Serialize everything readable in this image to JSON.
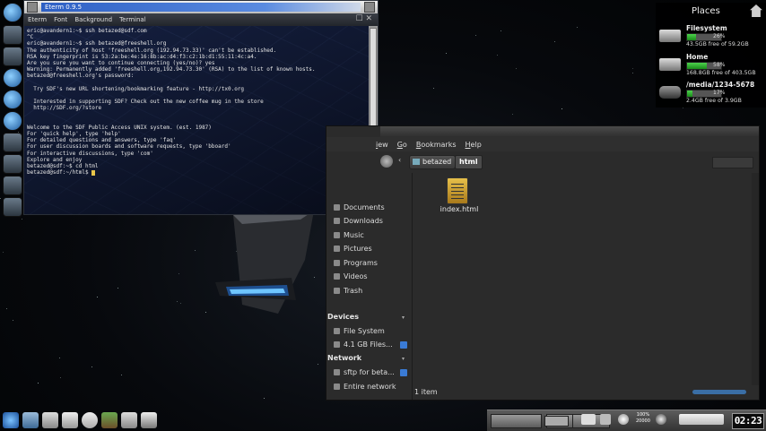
{
  "terminal": {
    "title": "Eterm 0.9.5",
    "menu": [
      "Eterm",
      "Font",
      "Background",
      "Terminal"
    ],
    "lines": [
      "eric@avandern1:~$ ssh betazed@sdf.com",
      "^C",
      "eric@avandern1:~$ ssh betazed@freeshell.org",
      "The authenticity of host 'freeshell.org (192.94.73.33)' can't be established.",
      "RSA key fingerprint is 53:2a:be:4e:16:8b:ac:d4:f3:c2:1b:d1:55:11:4c:a4.",
      "Are you sure you want to continue connecting (yes/no)? yes",
      "Warning: Permanently added 'freeshell.org,192.94.73.30' (RSA) to the list of known hosts.",
      "betazed@freeshell.org's password:",
      "",
      "  Try SDF's new URL shortening/bookmarking feature - http://tx0.org",
      "",
      "  Interested in supporting SDF? Check out the new coffee mug in the store",
      "  http://SDF.org/?store",
      "",
      "",
      "Welcome to the SDF Public Access UNIX system. (est. 1987)",
      "For 'quick help', type 'help'",
      "For detailed questions and answers, type 'faq'",
      "For user discussion boards and software requests, type 'bboard'",
      "For interactive discussions, type 'com'",
      "Explore and enjoy",
      "betazed@sdf:~$ cd html",
      "betazed@sdf:~/html$ "
    ]
  },
  "filemanager": {
    "menu": [
      "iew",
      "Go",
      "Bookmarks",
      "Help"
    ],
    "breadcrumbs": [
      "betazed",
      "html"
    ],
    "sidebar": {
      "places": [
        "Documents",
        "Downloads",
        "Music",
        "Pictures",
        "Programs",
        "Videos",
        "Trash"
      ],
      "devices_header": "Devices",
      "devices": [
        "File System",
        "4.1 GB Files..."
      ],
      "network_header": "Network",
      "network": [
        "sftp for beta...",
        "Entire network"
      ]
    },
    "files": [
      {
        "name": "index.html"
      }
    ],
    "status": "1 item"
  },
  "places_widget": {
    "title": "Places",
    "items": [
      {
        "name": "Filesystem",
        "pct": "26%",
        "fill": 26,
        "free": "43.5GB free of 59.2GB"
      },
      {
        "name": "Home",
        "pct": "58%",
        "fill": 58,
        "free": "168.8GB free of 403.5GB"
      },
      {
        "name": "/media/1234-5678",
        "pct": "17%",
        "fill": 17,
        "free": "2.4GB free of 3.9GB"
      }
    ]
  },
  "panel": {
    "tray_pct_top": "100%",
    "tray_pct_bottom": "20000",
    "clock": "02:23"
  }
}
